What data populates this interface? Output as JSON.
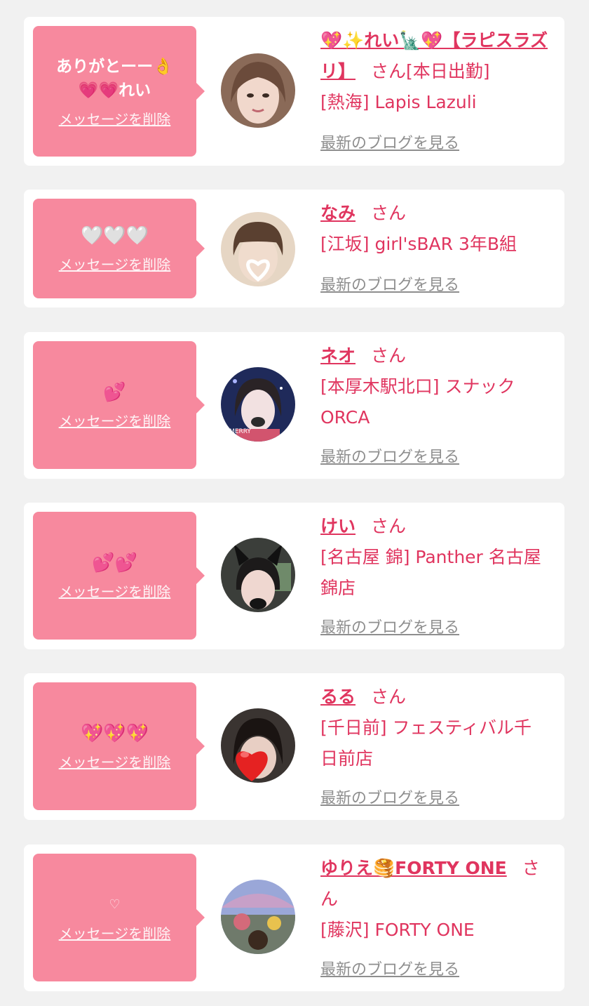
{
  "colors": {
    "page_bg": "#f1f1f1",
    "card_bg": "#ffffff",
    "bubble_pink": "#f7899e",
    "accent_red": "#e0355f",
    "link_gray": "#8e8e8e"
  },
  "delete_label": "メッセージを削除",
  "blog_label": "最新のブログを見る",
  "honorific": "さん",
  "items": [
    {
      "message": "ありがとーー👌💗💗れい",
      "name": "💖✨れい🗽💖【ラピスラズリ】",
      "honorific_tail": "[本日出勤]",
      "shop": "[熱海] Lapis Lazuli",
      "avatar_icon": "woman-portrait"
    },
    {
      "message": "🤍🤍🤍",
      "name": "なみ",
      "honorific_tail": "",
      "shop": "[江坂] girl'sBAR 3年B組",
      "avatar_icon": "woman-portrait-heart-sticker"
    },
    {
      "message": "💕",
      "name": "ネオ",
      "honorific_tail": "",
      "shop": "[本厚木駅北口] スナック ORCA",
      "avatar_icon": "woman-christmas-photo"
    },
    {
      "message": "💕💕",
      "name": "けい",
      "honorific_tail": "",
      "shop": "[名古屋 錦] Panther 名古屋錦店",
      "avatar_icon": "woman-cat-ears"
    },
    {
      "message": "💖💖💖",
      "name": "るる",
      "honorific_tail": "",
      "shop": "[千日前] フェスティバル千日前店",
      "avatar_icon": "woman-heart-sticker"
    },
    {
      "message": "♡",
      "name": "ゆりえ🥞FORTY ONE",
      "honorific_tail": "",
      "shop": "[藤沢] FORTY ONE",
      "avatar_icon": "outdoor-scene"
    }
  ]
}
